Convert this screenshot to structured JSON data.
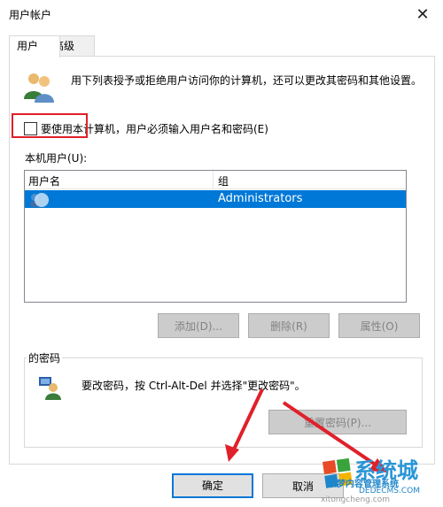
{
  "window": {
    "title": "用户帐户",
    "close_symbol": "✕"
  },
  "tabs": [
    {
      "label": "用户"
    },
    {
      "label": "高级"
    }
  ],
  "description": "用下列表授予或拒绝用户访问你的计算机，还可以更改其密码和其他设置。",
  "require_password": {
    "label": "要使用本计算机，用户必须输入用户名和密码(E)",
    "checked": false
  },
  "users_label": "本机用户(U):",
  "table": {
    "columns": [
      "用户名",
      "组"
    ],
    "rows": [
      {
        "username": "",
        "group": "Administrators",
        "selected": true
      }
    ]
  },
  "buttons": {
    "add": "添加(D)...",
    "remove": "删除(R)",
    "properties": "属性(O)"
  },
  "password_group": {
    "title": "的密码",
    "text": "要改密码，按 Ctrl-Alt-Del 并选择\"更改密码\"。",
    "reset_button": "重置密码(P)..."
  },
  "footer": {
    "ok": "确定",
    "cancel": "取消"
  },
  "watermark": {
    "brand": "系统城",
    "line1": "织梦内容管理系统",
    "line2": "DEDECMS.COM",
    "line3": "xitongcheng.com"
  },
  "colors": {
    "selection": "#0078d7",
    "annotation_red": "#e0202a"
  }
}
